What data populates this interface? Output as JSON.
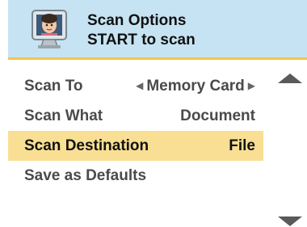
{
  "header": {
    "title": "Scan Options",
    "subtitle": "START to scan",
    "icon": "monitor-photo-icon"
  },
  "menu": {
    "items": [
      {
        "label": "Scan To",
        "value": "Memory Card",
        "has_arrows": true,
        "selected": false
      },
      {
        "label": "Scan What",
        "value": "Document",
        "has_arrows": false,
        "selected": false
      },
      {
        "label": "Scan Destination",
        "value": "File",
        "has_arrows": false,
        "selected": true
      },
      {
        "label": "Save as Defaults",
        "value": "",
        "has_arrows": false,
        "selected": false
      }
    ]
  },
  "scroll": {
    "up_icon": "scroll-up-arrow-icon",
    "down_icon": "scroll-down-arrow-icon"
  },
  "colors": {
    "header_bg": "#c6e3f3",
    "header_border": "#f0c64a",
    "selected_bg": "#f8df93",
    "text_normal": "#4a4a4a",
    "text_selected": "#111111"
  }
}
